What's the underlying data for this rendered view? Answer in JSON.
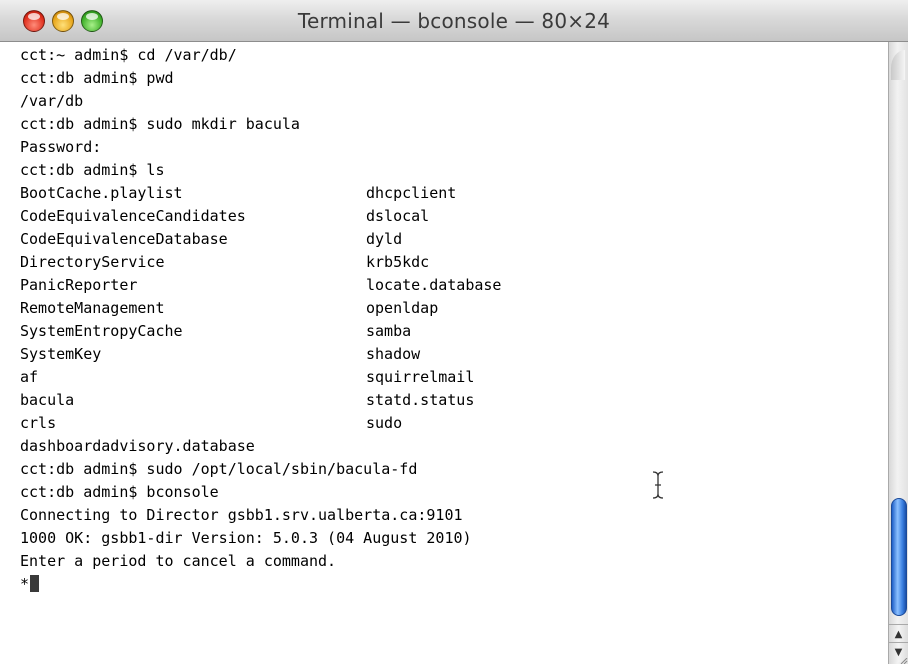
{
  "window": {
    "title": "Terminal — bconsole — 80×24"
  },
  "terminal": {
    "lines": [
      {
        "text": "cct:~ admin$ cd /var/db/"
      },
      {
        "text": "cct:db admin$ pwd"
      },
      {
        "text": "/var/db"
      },
      {
        "text": "cct:db admin$ sudo mkdir bacula"
      },
      {
        "text": "Password:"
      },
      {
        "text": "cct:db admin$ ls"
      },
      {
        "text": "BootCache.playlist",
        "col2": "dhcpclient"
      },
      {
        "text": "CodeEquivalenceCandidates",
        "col2": "dslocal"
      },
      {
        "text": "CodeEquivalenceDatabase",
        "col2": "dyld"
      },
      {
        "text": "DirectoryService",
        "col2": "krb5kdc"
      },
      {
        "text": "PanicReporter",
        "col2": "locate.database"
      },
      {
        "text": "RemoteManagement",
        "col2": "openldap"
      },
      {
        "text": "SystemEntropyCache",
        "col2": "samba"
      },
      {
        "text": "SystemKey",
        "col2": "shadow"
      },
      {
        "text": "af",
        "col2": "squirrelmail"
      },
      {
        "text": "bacula",
        "col2": "statd.status"
      },
      {
        "text": "crls",
        "col2": "sudo"
      },
      {
        "text": "dashboardadvisory.database"
      },
      {
        "text": "cct:db admin$ sudo /opt/local/sbin/bacula-fd"
      },
      {
        "text": "cct:db admin$ bconsole"
      },
      {
        "text": "Connecting to Director gsbb1.srv.ualberta.ca:9101"
      },
      {
        "text": "1000 OK: gsbb1-dir Version: 5.0.3 (04 August 2010)"
      },
      {
        "text": "Enter a period to cancel a command."
      },
      {
        "text": "*"
      }
    ]
  },
  "scrollbar": {
    "up_arrow_icon": "▲",
    "down_arrow_icon": "▼"
  }
}
